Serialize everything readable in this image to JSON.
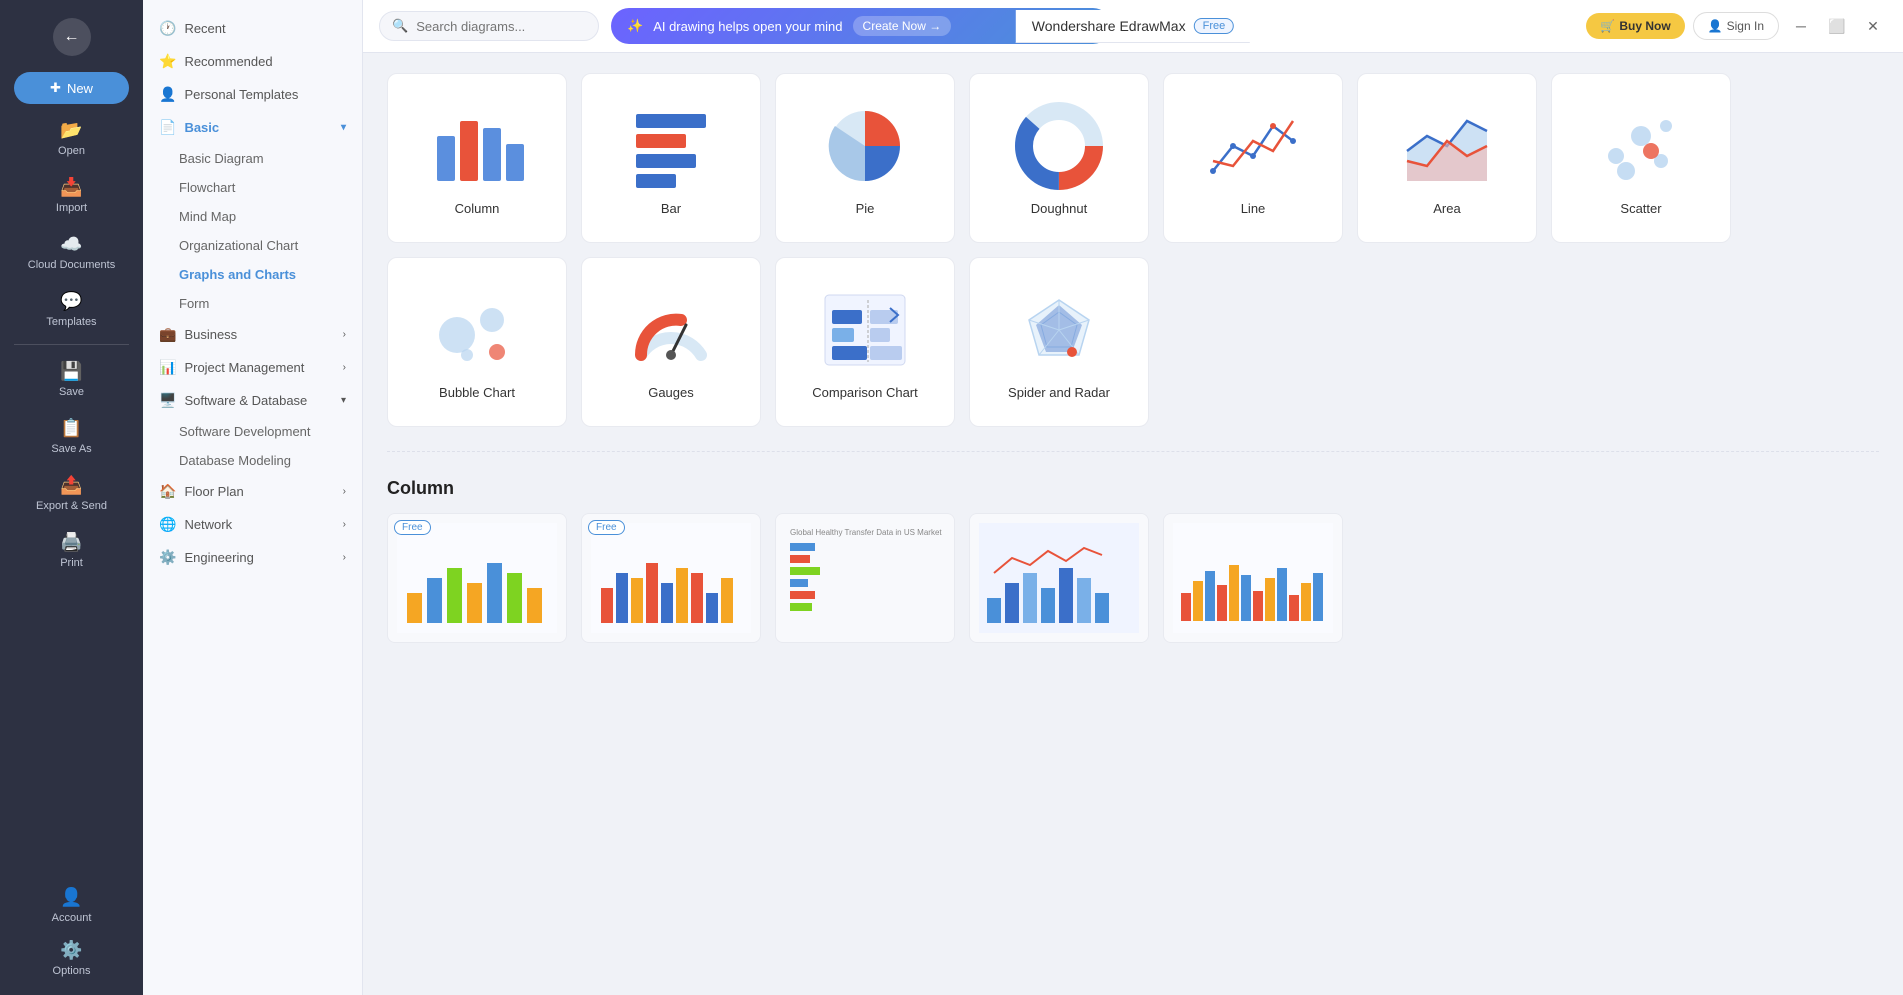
{
  "app": {
    "title": "Wondershare EdrawMax",
    "badge": "Free",
    "window_controls": [
      "minimize",
      "maximize",
      "close"
    ]
  },
  "topbar": {
    "search_placeholder": "Search diagrams...",
    "ai_banner_text": "AI drawing helps open your mind",
    "create_now_label": "Create Now →",
    "buy_now_label": "Buy Now",
    "sign_in_label": "Sign In"
  },
  "sidebar_left": {
    "back_icon": "←",
    "items": [
      {
        "id": "new",
        "label": "New",
        "icon": "+"
      },
      {
        "id": "open",
        "label": "Open",
        "icon": "📂"
      },
      {
        "id": "import",
        "label": "Import",
        "icon": "📥"
      },
      {
        "id": "cloud",
        "label": "Cloud Documents",
        "icon": "☁️"
      },
      {
        "id": "templates",
        "label": "Templates",
        "icon": "💬"
      },
      {
        "id": "save",
        "label": "Save",
        "icon": "💾"
      },
      {
        "id": "save-as",
        "label": "Save As",
        "icon": "📋"
      },
      {
        "id": "export",
        "label": "Export & Send",
        "icon": "📤"
      },
      {
        "id": "print",
        "label": "Print",
        "icon": "🖨️"
      }
    ],
    "bottom_items": [
      {
        "id": "account",
        "label": "Account",
        "icon": "👤"
      },
      {
        "id": "options",
        "label": "Options",
        "icon": "⚙️"
      }
    ]
  },
  "sidebar_mid": {
    "sections": [
      {
        "id": "recent",
        "label": "Recent",
        "icon": "🕐",
        "expanded": false
      },
      {
        "id": "recommended",
        "label": "Recommended",
        "icon": "⭐",
        "expanded": false
      },
      {
        "id": "personal",
        "label": "Personal Templates",
        "icon": "👤",
        "expanded": false
      },
      {
        "id": "basic",
        "label": "Basic",
        "icon": "📄",
        "expanded": true,
        "active": true,
        "children": [
          {
            "id": "basic-diagram",
            "label": "Basic Diagram"
          },
          {
            "id": "flowchart",
            "label": "Flowchart"
          },
          {
            "id": "mind-map",
            "label": "Mind Map"
          },
          {
            "id": "org-chart",
            "label": "Organizational Chart"
          },
          {
            "id": "graphs-charts",
            "label": "Graphs and Charts",
            "active": true
          },
          {
            "id": "form",
            "label": "Form"
          }
        ]
      },
      {
        "id": "business",
        "label": "Business",
        "icon": "💼",
        "expanded": false
      },
      {
        "id": "project-mgmt",
        "label": "Project Management",
        "icon": "📊",
        "expanded": false
      },
      {
        "id": "software-db",
        "label": "Software & Database",
        "icon": "🖥️",
        "expanded": true,
        "children": [
          {
            "id": "software-dev",
            "label": "Software Development"
          },
          {
            "id": "db-modeling",
            "label": "Database Modeling"
          }
        ]
      },
      {
        "id": "floor-plan",
        "label": "Floor Plan",
        "icon": "🏠",
        "expanded": false
      },
      {
        "id": "network",
        "label": "Network",
        "icon": "🌐",
        "expanded": false
      },
      {
        "id": "engineering",
        "label": "Engineering",
        "icon": "⚙️",
        "expanded": false
      }
    ]
  },
  "chart_types": [
    {
      "id": "column",
      "label": "Column"
    },
    {
      "id": "bar",
      "label": "Bar"
    },
    {
      "id": "pie",
      "label": "Pie"
    },
    {
      "id": "doughnut",
      "label": "Doughnut"
    },
    {
      "id": "line",
      "label": "Line"
    },
    {
      "id": "area",
      "label": "Area"
    },
    {
      "id": "scatter",
      "label": "Scatter"
    },
    {
      "id": "bubble",
      "label": "Bubble Chart"
    },
    {
      "id": "gauges",
      "label": "Gauges"
    },
    {
      "id": "comparison",
      "label": "Comparison Chart"
    },
    {
      "id": "spider",
      "label": "Spider and Radar"
    }
  ],
  "section_label": "Column",
  "templates": [
    {
      "id": "t1",
      "free": true
    },
    {
      "id": "t2",
      "free": true
    },
    {
      "id": "t3",
      "free": false
    },
    {
      "id": "t4",
      "free": false
    },
    {
      "id": "t5",
      "free": false
    }
  ]
}
